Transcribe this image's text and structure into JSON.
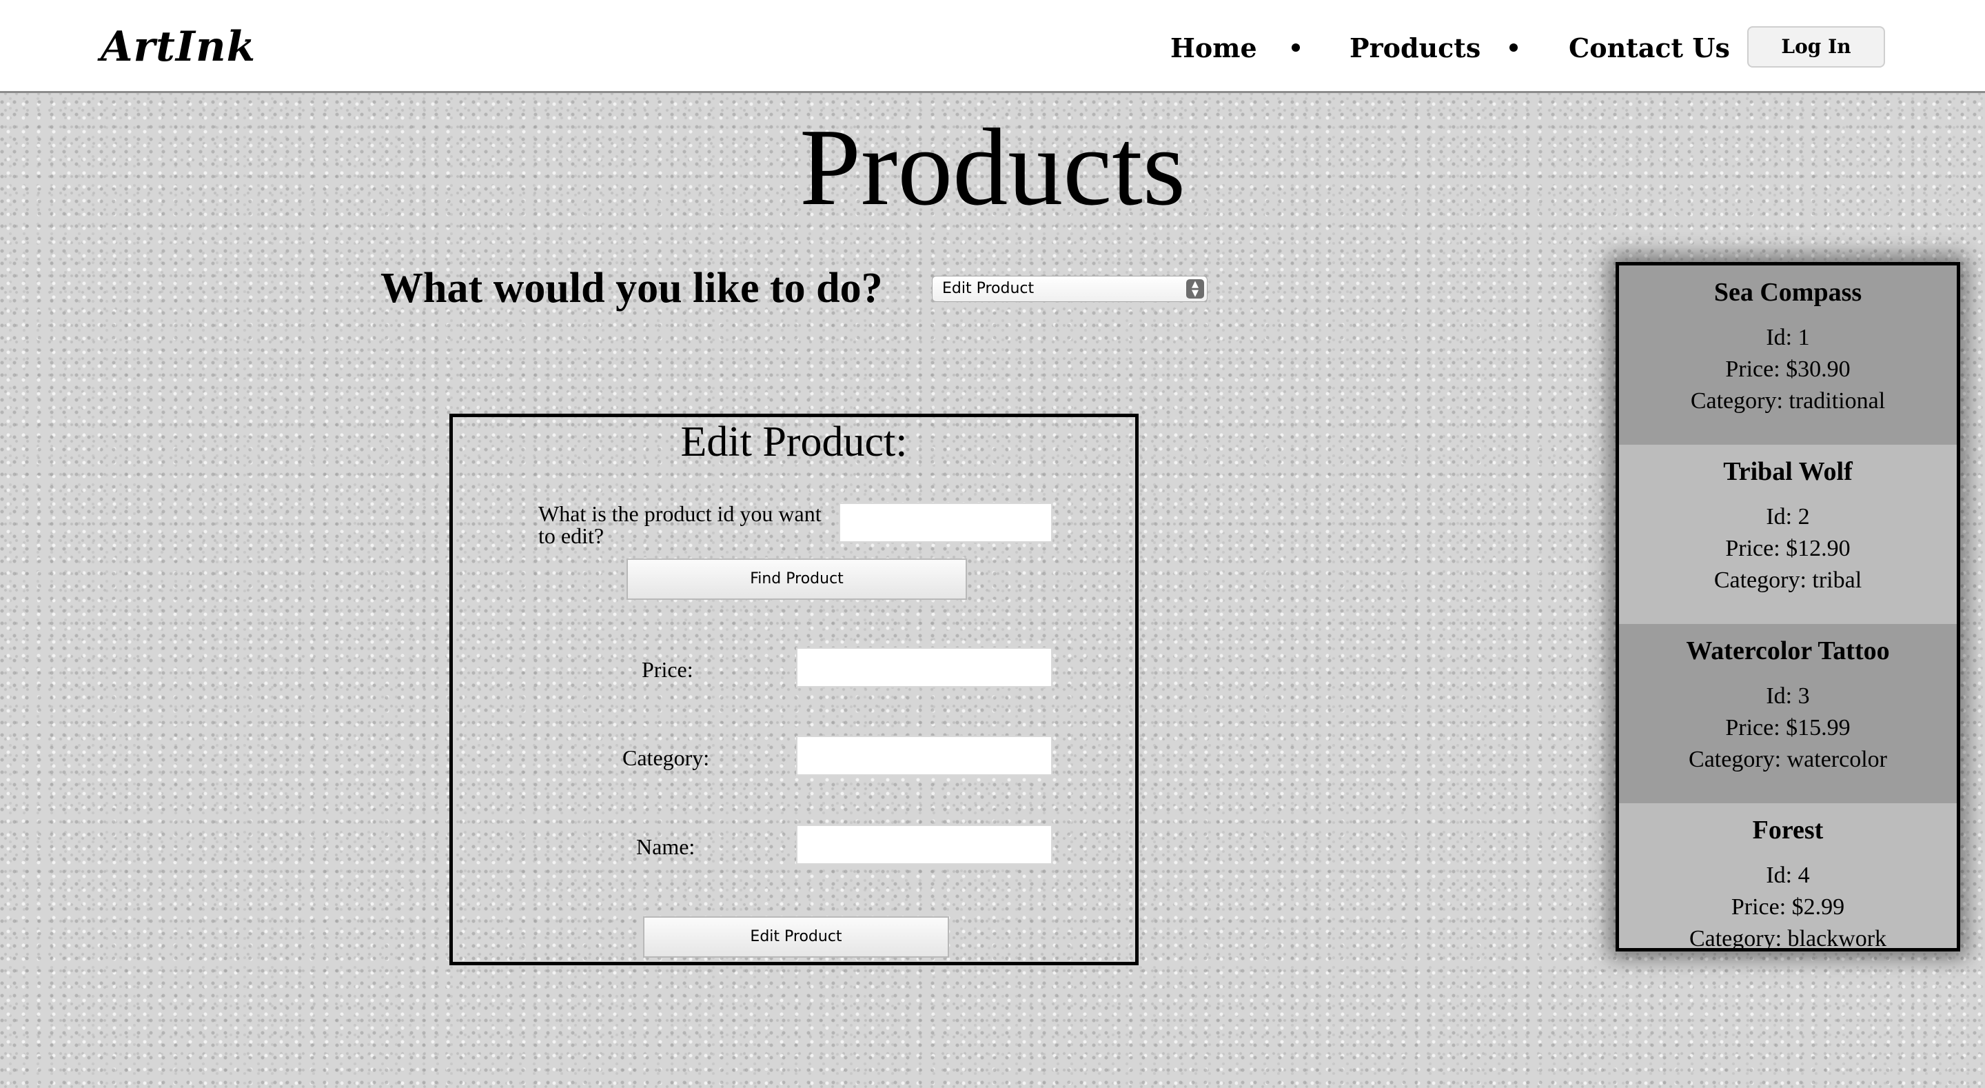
{
  "header": {
    "logo": "ArtInk",
    "nav": {
      "home": "Home",
      "products": "Products",
      "contact": "Contact Us"
    },
    "login_label": "Log In"
  },
  "main": {
    "title": "Products",
    "question": "What would you like to do?",
    "action_select": {
      "selected": "Edit Product"
    }
  },
  "edit_form": {
    "title": "Edit Product:",
    "product_id_label": "What is the product id you want to edit?",
    "product_id_value": "",
    "find_button": "Find Product",
    "price_label": "Price:",
    "price_value": "",
    "category_label": "Category:",
    "category_value": "",
    "name_label": "Name:",
    "name_value": "",
    "submit_button": "Edit Product"
  },
  "products": [
    {
      "name": "Sea Compass",
      "id": "Id: 1",
      "price": "Price: $30.90",
      "category": "Category: traditional"
    },
    {
      "name": "Tribal Wolf",
      "id": "Id: 2",
      "price": "Price: $12.90",
      "category": "Category: tribal"
    },
    {
      "name": "Watercolor Tattoo",
      "id": "Id: 3",
      "price": "Price: $15.99",
      "category": "Category: watercolor"
    },
    {
      "name": "Forest",
      "id": "Id: 4",
      "price": "Price: $2.99",
      "category": "Category: blackwork"
    }
  ],
  "colors": {
    "header_bg": "#ffffff",
    "page_bg": "#d6d6d6",
    "card_dark": "#9d9d9d",
    "card_light": "#bcbcbc",
    "border": "#000000"
  }
}
